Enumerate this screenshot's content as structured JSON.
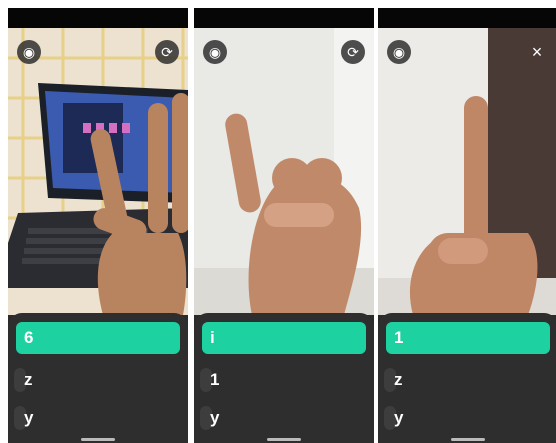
{
  "panels": [
    {
      "predictions": [
        "6",
        "z",
        "y"
      ],
      "left_icon": "camera-mode-icon",
      "right_icon": "switch-camera-icon"
    },
    {
      "predictions": [
        "i",
        "1",
        "y"
      ],
      "left_icon": "camera-mode-icon",
      "right_icon": "switch-camera-icon"
    },
    {
      "predictions": [
        "1",
        "z",
        "y"
      ],
      "left_icon": "camera-mode-icon",
      "right_icon": "close-icon"
    }
  ],
  "colors": {
    "accent": "#1dd1a1",
    "panel_bg": "#2e2e2e",
    "status_bar": "#060606"
  },
  "glyphs": {
    "camera_mode": "◉",
    "switch_camera": "⟳",
    "close": "×"
  }
}
